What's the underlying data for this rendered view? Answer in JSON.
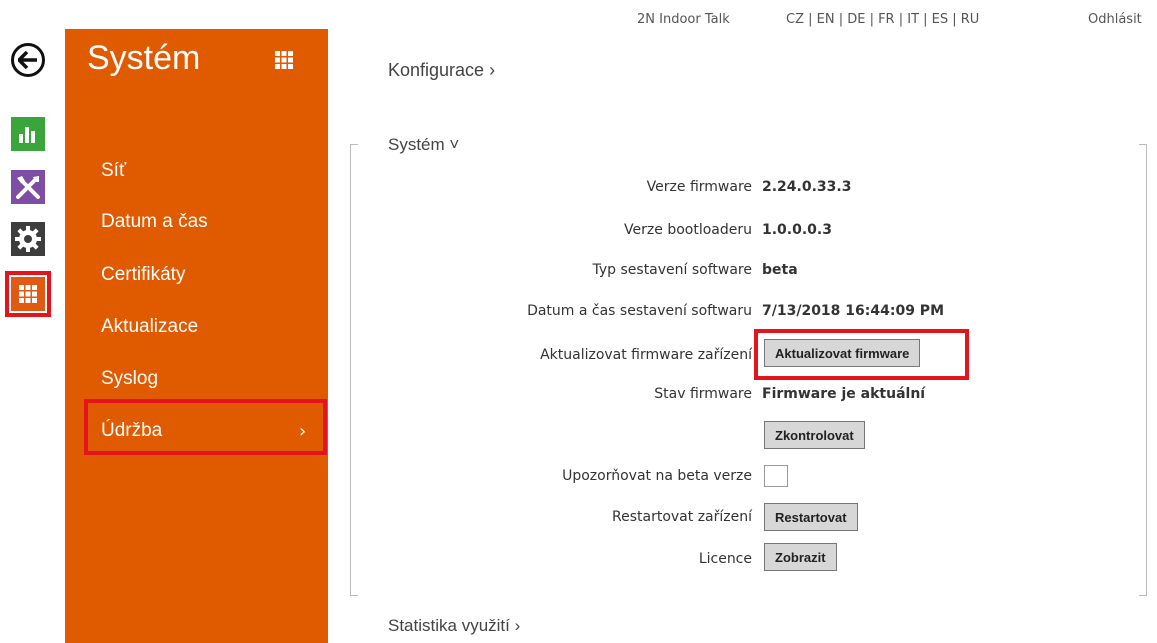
{
  "topbar": {
    "device_name": "2N Indoor Talk",
    "languages": "CZ | EN | DE | FR | IT | ES | RU",
    "logout": "Odhlásit"
  },
  "rail": {
    "items": [
      "back-arrow-icon",
      "statistics-icon",
      "tools-icon",
      "settings-icon",
      "apps-grid-icon"
    ],
    "colors": {
      "stats": "#3aa53a",
      "tools": "#7d4ea3",
      "gear": "#3d3d3d",
      "grid": "#e05a12"
    }
  },
  "sidebar": {
    "title": "Systém",
    "items": [
      {
        "label": "Síť"
      },
      {
        "label": "Datum a čas"
      },
      {
        "label": "Certifikáty"
      },
      {
        "label": "Aktualizace"
      },
      {
        "label": "Syslog"
      },
      {
        "label": "Údržba",
        "chevron": "›",
        "active": true
      }
    ],
    "background": "#e05a00"
  },
  "main": {
    "breadcrumb": "Konfigurace ›",
    "section_title": "Systém ˅",
    "footer_section": "Statistika využití ›",
    "rows": {
      "firmware_version_label": "Verze firmware",
      "firmware_version_value": "2.24.0.33.3",
      "bootloader_label": "Verze bootloaderu",
      "bootloader_value": "1.0.0.0.3",
      "build_type_label": "Typ sestavení software",
      "build_type_value": "beta",
      "build_date_label": "Datum a čas sestavení softwaru",
      "build_date_value": "7/13/2018 16:44:09 PM",
      "update_fw_label": "Aktualizovat firmware zařízení",
      "update_fw_button": "Aktualizovat firmware",
      "fw_status_label": "Stav firmware",
      "fw_status_value": "Firmware je aktuální",
      "check_button": "Zkontrolovat",
      "beta_notify_label": "Upozorňovat na beta verze",
      "restart_label": "Restartovat zařízení",
      "restart_button": "Restartovat",
      "license_label": "Licence",
      "license_button": "Zobrazit"
    }
  },
  "highlight_color": "#e3141c"
}
